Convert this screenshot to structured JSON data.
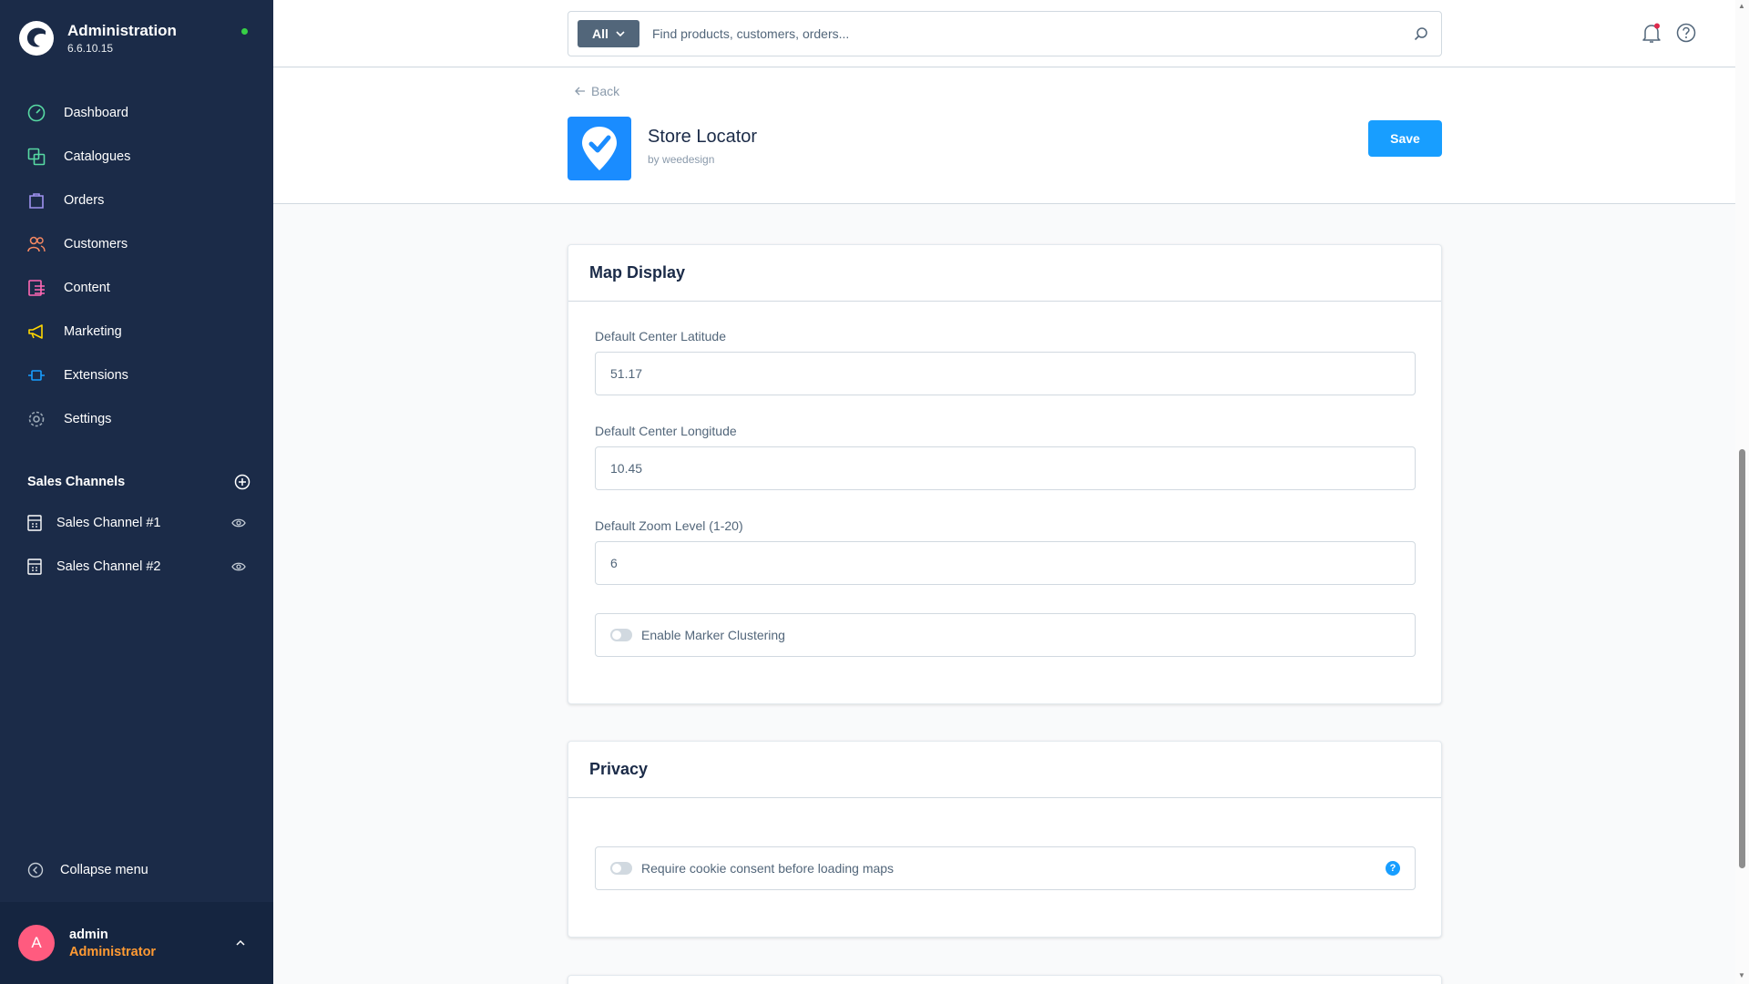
{
  "brand": {
    "title": "Administration",
    "version": "6.6.10.15"
  },
  "nav": {
    "items": [
      {
        "label": "Dashboard",
        "icon": "dashboard-icon",
        "color": "#57d9a3"
      },
      {
        "label": "Catalogues",
        "icon": "catalogue-icon",
        "color": "#57d9a3"
      },
      {
        "label": "Orders",
        "icon": "orders-icon",
        "color": "#a092f0"
      },
      {
        "label": "Customers",
        "icon": "customers-icon",
        "color": "#f88962"
      },
      {
        "label": "Content",
        "icon": "content-icon",
        "color": "#ff68b4"
      },
      {
        "label": "Marketing",
        "icon": "marketing-icon",
        "color": "#ffd700"
      },
      {
        "label": "Extensions",
        "icon": "extensions-icon",
        "color": "#189eff"
      },
      {
        "label": "Settings",
        "icon": "settings-icon",
        "color": "#9aa8b5"
      }
    ]
  },
  "sales_channels": {
    "title": "Sales Channels",
    "items": [
      {
        "label": "Sales Channel #1"
      },
      {
        "label": "Sales Channel #2"
      }
    ]
  },
  "collapse_label": "Collapse menu",
  "user": {
    "initial": "A",
    "name": "admin",
    "role": "Administrator"
  },
  "search": {
    "type_label": "All",
    "placeholder": "Find products, customers, orders..."
  },
  "header": {
    "back_label": "Back",
    "app_name": "Store Locator",
    "by_prefix": "by",
    "vendor": "weedesign",
    "save_label": "Save"
  },
  "map_display": {
    "title": "Map Display",
    "lat_label": "Default Center Latitude",
    "lat_value": "51.17",
    "lng_label": "Default Center Longitude",
    "lng_value": "10.45",
    "zoom_label": "Default Zoom Level (1-20)",
    "zoom_value": "6",
    "clustering_label": "Enable Marker Clustering"
  },
  "privacy": {
    "title": "Privacy",
    "consent_label": "Require cookie consent before loading maps"
  },
  "colors": {
    "sidebar": "#1b2b48",
    "primary": "#189eff",
    "avatar": "#ff5b7f",
    "role": "#ff9a33"
  }
}
